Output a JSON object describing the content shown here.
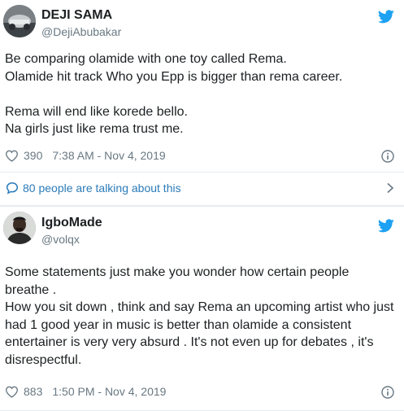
{
  "tweets": [
    {
      "author": "DEJI SAMA",
      "handle": "@DejiAbubakar",
      "lines": [
        "Be comparing olamide with one toy called Rema.",
        "Olamide hit track Who you Epp is bigger than rema career.",
        "",
        "Rema will end like korede bello.",
        "Na girls just like rema trust me."
      ],
      "likes": "390",
      "timestamp": "7:38 AM - Nov 4, 2019",
      "talking": "80 people are talking about this"
    },
    {
      "author": "IgboMade",
      "handle": "@volqx",
      "lines": [
        "Some statements just make you wonder how certain people",
        "breathe .",
        "How you sit down , think and say Rema an upcoming artist who just",
        "had 1 good year in music is better than olamide a consistent",
        "entertainer is very very absurd . It's not even up for debates , it's",
        "disrespectful."
      ],
      "likes": "883",
      "timestamp": "1:50 PM - Nov 4, 2019"
    }
  ],
  "colors": {
    "link": "#2b7bb9",
    "bird": "#1da1f2",
    "muted": "#697882",
    "text": "#1c2022"
  },
  "icons": [
    "twitter-bird-icon",
    "heart-icon",
    "info-icon",
    "speech-bubble-icon",
    "chevron-right-icon"
  ]
}
